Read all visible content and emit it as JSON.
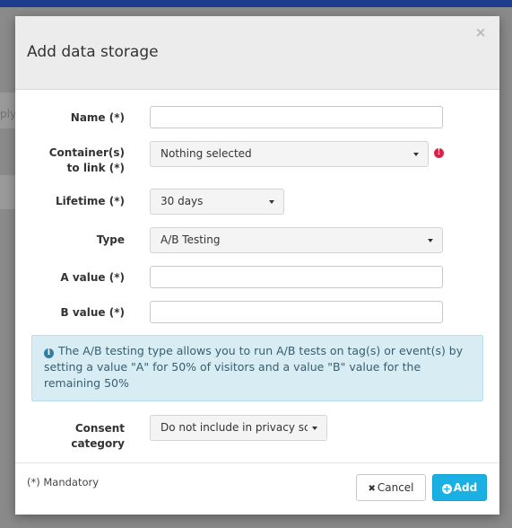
{
  "background": {
    "partial_text": "ply"
  },
  "modal": {
    "title": "Add data storage",
    "close_label": "×"
  },
  "form": {
    "name": {
      "label": "Name (*)",
      "value": ""
    },
    "containers": {
      "label": "Container(s) to link (*)",
      "selected": "Nothing selected",
      "alert_icon": "exclamation-circle-icon"
    },
    "lifetime": {
      "label": "Lifetime (*)",
      "selected": "30 days"
    },
    "type": {
      "label": "Type",
      "selected": "A/B Testing"
    },
    "a_value": {
      "label": "A value (*)",
      "value": ""
    },
    "b_value": {
      "label": "B value (*)",
      "value": ""
    },
    "info": {
      "text": "The A/B testing type allows you to run A/B tests on tag(s) or event(s) by setting a value \"A\" for 50% of visitors and a value \"B\" value for the remaining 50%"
    },
    "consent": {
      "label": "Consent category",
      "selected": "Do not include in privacy sco"
    }
  },
  "footer": {
    "mandatory_note": "(*) Mandatory",
    "cancel_label": "Cancel",
    "add_label": "Add"
  },
  "colors": {
    "primary": "#1ab0e4",
    "alert": "#d9224a",
    "info_bg": "#d8ecf4",
    "topbar": "#1e3d8f"
  }
}
